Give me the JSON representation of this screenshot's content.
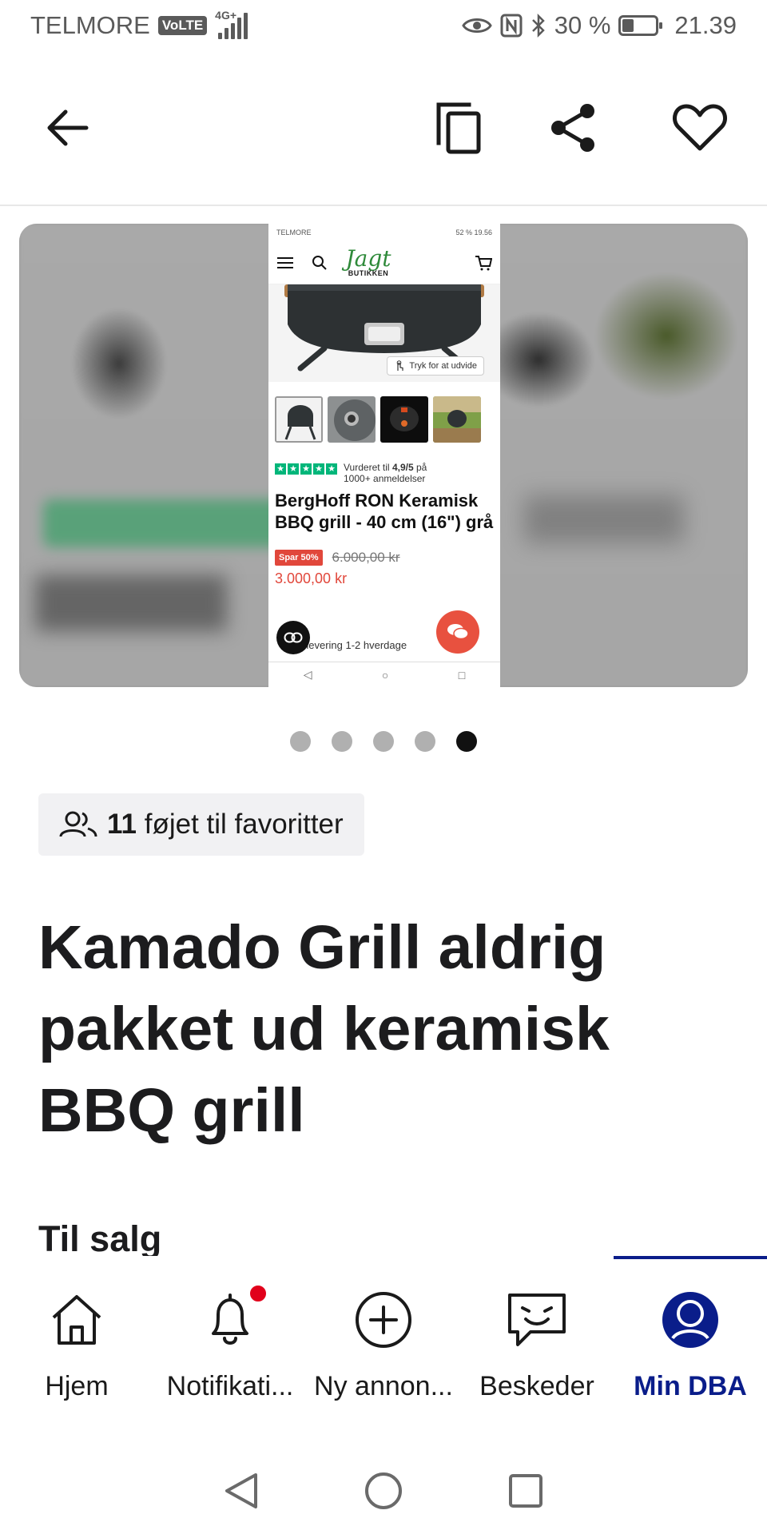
{
  "status_bar": {
    "carrier": "TELMORE",
    "volte": "VoLTE",
    "network": "4G+",
    "battery": "30 %",
    "battery_level": 0.3,
    "time": "21.39"
  },
  "toolbar": {
    "back_icon": "arrow-left-icon",
    "copy_icon": "copy-icon",
    "share_icon": "share-icon",
    "favorite_icon": "heart-icon"
  },
  "carousel": {
    "image_count": 5,
    "active_index": 5,
    "screenshot": {
      "status_left": "TELMORE",
      "status_right": "52 % 19.56",
      "logo_line1": "Jagt",
      "logo_line2": "BUTIKKEN",
      "expand_label": "Tryk for at udvide",
      "rating_text": "Vurderet til",
      "rating_value": "4,9/5",
      "rating_text2": "på",
      "rating_text3": "1000+ anmeldelser",
      "product_title": "BergHoff RON Keramisk BBQ grill - 40 cm (16\") grå",
      "save_badge": "Spar 50%",
      "old_price": "6.000,00 kr",
      "new_price": "3.000,00 kr",
      "delivery": "tig levering 1-2 hverdage"
    }
  },
  "favorites": {
    "count": "11",
    "label": "føjet til favoritter"
  },
  "listing": {
    "title": "Kamado Grill aldrig pakket ud keramisk BBQ grill",
    "section": "Til salg"
  },
  "bottom_nav": {
    "items": [
      {
        "label": "Hjem",
        "icon": "home-icon"
      },
      {
        "label": "Notifikati...",
        "icon": "bell-icon"
      },
      {
        "label": "Ny annon...",
        "icon": "plus-circle-icon"
      },
      {
        "label": "Beskeder",
        "icon": "chat-icon"
      },
      {
        "label": "Min DBA",
        "icon": "profile-icon"
      }
    ],
    "active": "Min DBA"
  },
  "colors": {
    "accent": "#0a1d8a",
    "badge": "#e1001b",
    "sale": "#e1473b",
    "trustpilot": "#00b67a"
  }
}
